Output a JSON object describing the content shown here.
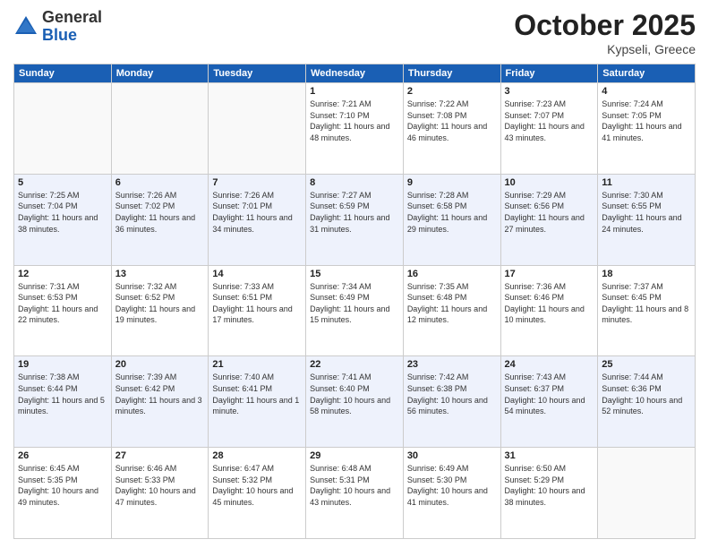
{
  "logo": {
    "general": "General",
    "blue": "Blue"
  },
  "header": {
    "month": "October 2025",
    "location": "Kypseli, Greece"
  },
  "days_of_week": [
    "Sunday",
    "Monday",
    "Tuesday",
    "Wednesday",
    "Thursday",
    "Friday",
    "Saturday"
  ],
  "weeks": [
    [
      {
        "day": "",
        "content": ""
      },
      {
        "day": "",
        "content": ""
      },
      {
        "day": "",
        "content": ""
      },
      {
        "day": "1",
        "content": "Sunrise: 7:21 AM\nSunset: 7:10 PM\nDaylight: 11 hours and 48 minutes."
      },
      {
        "day": "2",
        "content": "Sunrise: 7:22 AM\nSunset: 7:08 PM\nDaylight: 11 hours and 46 minutes."
      },
      {
        "day": "3",
        "content": "Sunrise: 7:23 AM\nSunset: 7:07 PM\nDaylight: 11 hours and 43 minutes."
      },
      {
        "day": "4",
        "content": "Sunrise: 7:24 AM\nSunset: 7:05 PM\nDaylight: 11 hours and 41 minutes."
      }
    ],
    [
      {
        "day": "5",
        "content": "Sunrise: 7:25 AM\nSunset: 7:04 PM\nDaylight: 11 hours and 38 minutes."
      },
      {
        "day": "6",
        "content": "Sunrise: 7:26 AM\nSunset: 7:02 PM\nDaylight: 11 hours and 36 minutes."
      },
      {
        "day": "7",
        "content": "Sunrise: 7:26 AM\nSunset: 7:01 PM\nDaylight: 11 hours and 34 minutes."
      },
      {
        "day": "8",
        "content": "Sunrise: 7:27 AM\nSunset: 6:59 PM\nDaylight: 11 hours and 31 minutes."
      },
      {
        "day": "9",
        "content": "Sunrise: 7:28 AM\nSunset: 6:58 PM\nDaylight: 11 hours and 29 minutes."
      },
      {
        "day": "10",
        "content": "Sunrise: 7:29 AM\nSunset: 6:56 PM\nDaylight: 11 hours and 27 minutes."
      },
      {
        "day": "11",
        "content": "Sunrise: 7:30 AM\nSunset: 6:55 PM\nDaylight: 11 hours and 24 minutes."
      }
    ],
    [
      {
        "day": "12",
        "content": "Sunrise: 7:31 AM\nSunset: 6:53 PM\nDaylight: 11 hours and 22 minutes."
      },
      {
        "day": "13",
        "content": "Sunrise: 7:32 AM\nSunset: 6:52 PM\nDaylight: 11 hours and 19 minutes."
      },
      {
        "day": "14",
        "content": "Sunrise: 7:33 AM\nSunset: 6:51 PM\nDaylight: 11 hours and 17 minutes."
      },
      {
        "day": "15",
        "content": "Sunrise: 7:34 AM\nSunset: 6:49 PM\nDaylight: 11 hours and 15 minutes."
      },
      {
        "day": "16",
        "content": "Sunrise: 7:35 AM\nSunset: 6:48 PM\nDaylight: 11 hours and 12 minutes."
      },
      {
        "day": "17",
        "content": "Sunrise: 7:36 AM\nSunset: 6:46 PM\nDaylight: 11 hours and 10 minutes."
      },
      {
        "day": "18",
        "content": "Sunrise: 7:37 AM\nSunset: 6:45 PM\nDaylight: 11 hours and 8 minutes."
      }
    ],
    [
      {
        "day": "19",
        "content": "Sunrise: 7:38 AM\nSunset: 6:44 PM\nDaylight: 11 hours and 5 minutes."
      },
      {
        "day": "20",
        "content": "Sunrise: 7:39 AM\nSunset: 6:42 PM\nDaylight: 11 hours and 3 minutes."
      },
      {
        "day": "21",
        "content": "Sunrise: 7:40 AM\nSunset: 6:41 PM\nDaylight: 11 hours and 1 minute."
      },
      {
        "day": "22",
        "content": "Sunrise: 7:41 AM\nSunset: 6:40 PM\nDaylight: 10 hours and 58 minutes."
      },
      {
        "day": "23",
        "content": "Sunrise: 7:42 AM\nSunset: 6:38 PM\nDaylight: 10 hours and 56 minutes."
      },
      {
        "day": "24",
        "content": "Sunrise: 7:43 AM\nSunset: 6:37 PM\nDaylight: 10 hours and 54 minutes."
      },
      {
        "day": "25",
        "content": "Sunrise: 7:44 AM\nSunset: 6:36 PM\nDaylight: 10 hours and 52 minutes."
      }
    ],
    [
      {
        "day": "26",
        "content": "Sunrise: 6:45 AM\nSunset: 5:35 PM\nDaylight: 10 hours and 49 minutes."
      },
      {
        "day": "27",
        "content": "Sunrise: 6:46 AM\nSunset: 5:33 PM\nDaylight: 10 hours and 47 minutes."
      },
      {
        "day": "28",
        "content": "Sunrise: 6:47 AM\nSunset: 5:32 PM\nDaylight: 10 hours and 45 minutes."
      },
      {
        "day": "29",
        "content": "Sunrise: 6:48 AM\nSunset: 5:31 PM\nDaylight: 10 hours and 43 minutes."
      },
      {
        "day": "30",
        "content": "Sunrise: 6:49 AM\nSunset: 5:30 PM\nDaylight: 10 hours and 41 minutes."
      },
      {
        "day": "31",
        "content": "Sunrise: 6:50 AM\nSunset: 5:29 PM\nDaylight: 10 hours and 38 minutes."
      },
      {
        "day": "",
        "content": ""
      }
    ]
  ]
}
